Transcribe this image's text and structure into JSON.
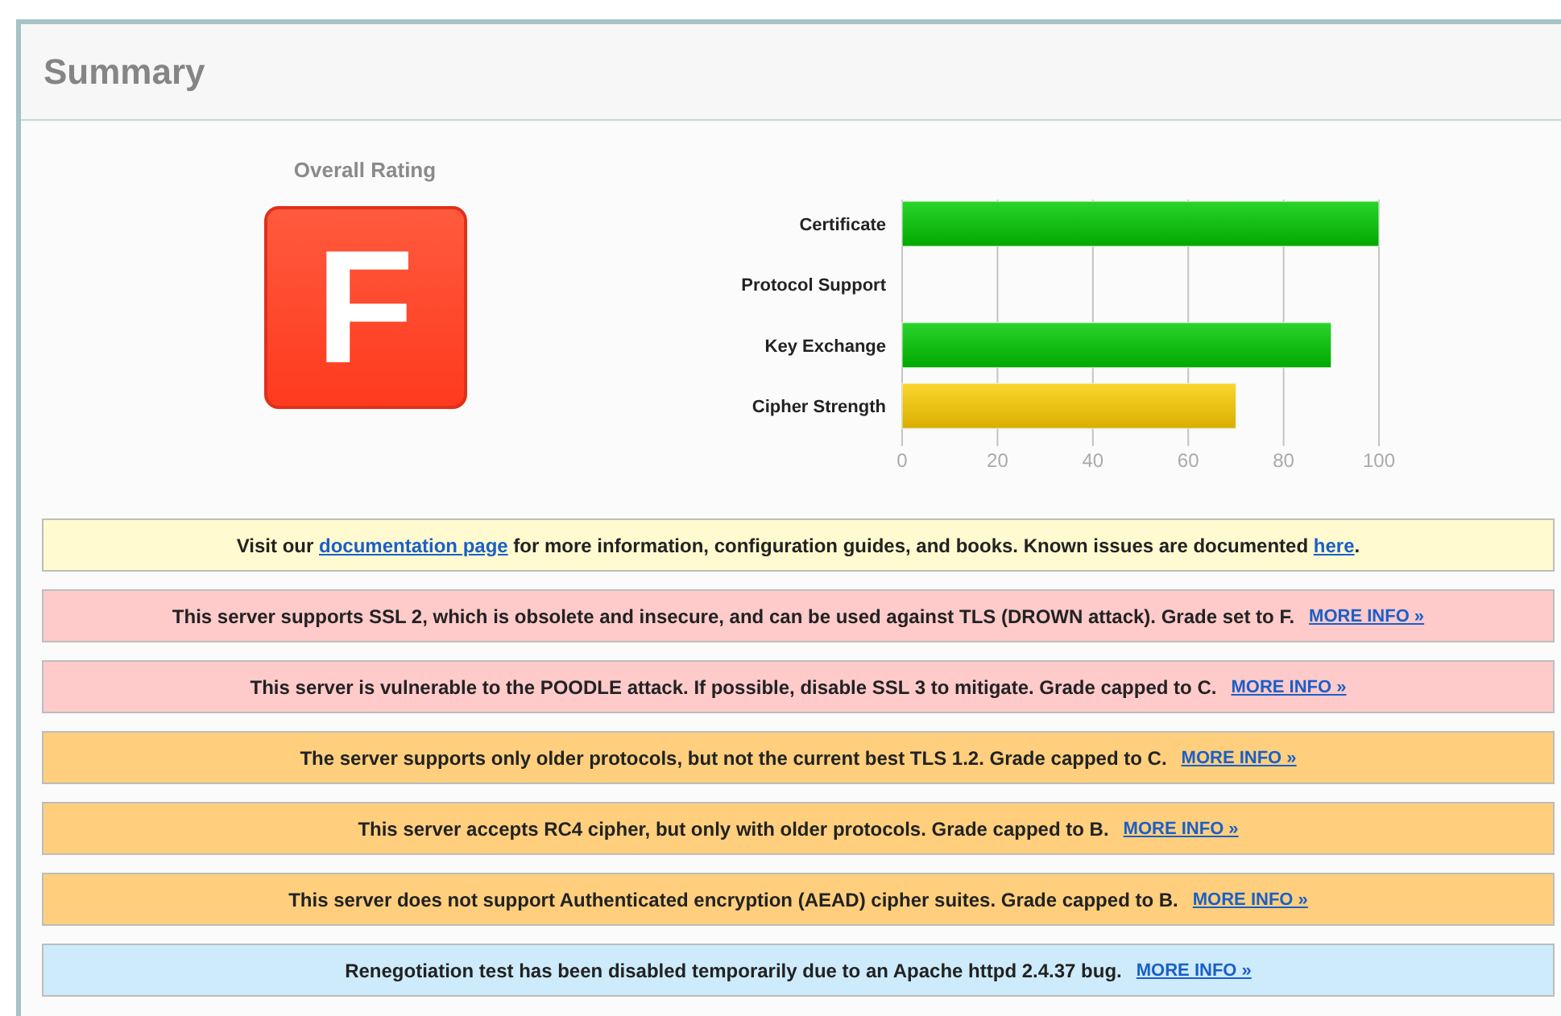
{
  "summary": {
    "title": "Summary",
    "rating": {
      "label": "Overall Rating",
      "grade": "F"
    },
    "chart_data": {
      "type": "bar",
      "orientation": "horizontal",
      "categories": [
        "Certificate",
        "Protocol Support",
        "Key Exchange",
        "Cipher Strength"
      ],
      "values": [
        100,
        0,
        90,
        70
      ],
      "xlim": [
        0,
        100
      ],
      "grid": true,
      "xticks": [
        0,
        20,
        40,
        60,
        80,
        100
      ]
    },
    "messages": [
      {
        "kind": "info",
        "parts": [
          {
            "text": "Visit our "
          },
          {
            "link": "documentation page"
          },
          {
            "text": " for more information, configuration guides, and books. Known issues are documented "
          },
          {
            "link": "here"
          },
          {
            "text": "."
          }
        ]
      },
      {
        "kind": "error",
        "parts": [
          {
            "text": "This server supports SSL 2, which is obsolete and insecure, and can be used against TLS (DROWN attack). Grade set to F."
          }
        ],
        "more": "MORE INFO »"
      },
      {
        "kind": "error",
        "parts": [
          {
            "text": "This server is vulnerable to the POODLE attack. If possible, disable SSL 3 to mitigate. Grade capped to C."
          }
        ],
        "more": "MORE INFO »"
      },
      {
        "kind": "warning",
        "parts": [
          {
            "text": "The server supports only older protocols, but not the current best TLS 1.2. Grade capped to C."
          }
        ],
        "more": "MORE INFO »"
      },
      {
        "kind": "warning",
        "parts": [
          {
            "text": "This server accepts RC4 cipher, but only with older protocols. Grade capped to B."
          }
        ],
        "more": "MORE INFO »"
      },
      {
        "kind": "warning",
        "parts": [
          {
            "text": "This server does not support Authenticated encryption (AEAD) cipher suites. Grade capped to B."
          }
        ],
        "more": "MORE INFO »"
      },
      {
        "kind": "notice",
        "parts": [
          {
            "text": "Renegotiation test has been disabled temporarily due to an Apache httpd 2.4.37 bug."
          }
        ],
        "more": "MORE INFO »"
      }
    ]
  }
}
